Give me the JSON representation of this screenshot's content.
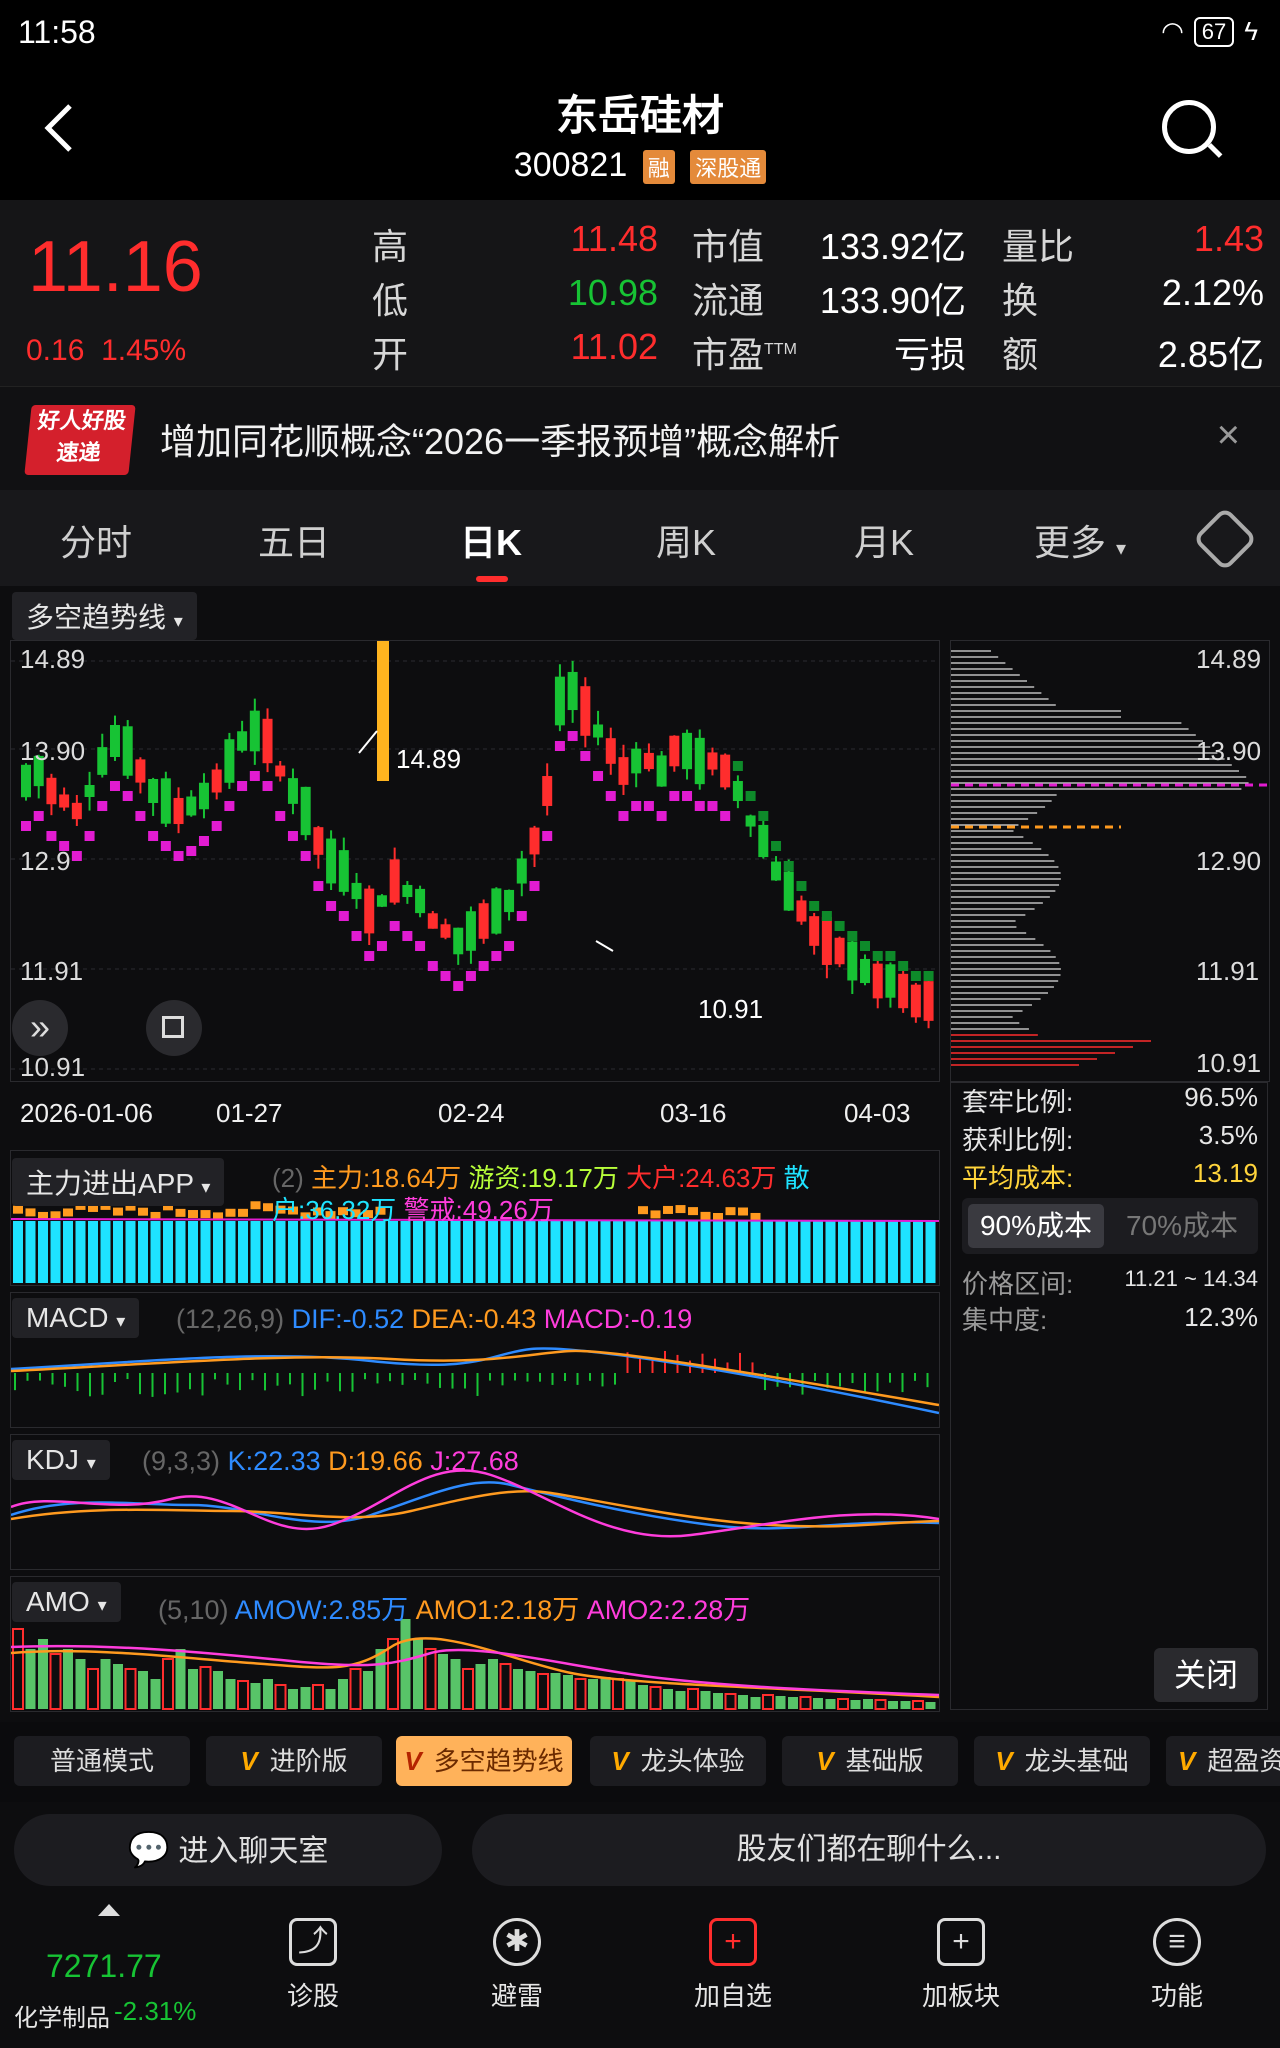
{
  "status": {
    "time": "11:58",
    "battery": "67"
  },
  "header": {
    "title": "东岳硅材",
    "code": "300821",
    "tag_margin": "融",
    "tag_connect": "深股通"
  },
  "quote": {
    "price": "11.16",
    "change": "0.16",
    "change_pct": "1.45%",
    "rows": [
      {
        "l1": "高",
        "v1": "11.48",
        "l2": "市值",
        "v2": "133.92亿",
        "l3": "量比",
        "v3": "1.43"
      },
      {
        "l1": "低",
        "v1": "10.98",
        "l2": "流通",
        "v2": "133.90亿",
        "l3": "换",
        "v3": "2.12%"
      },
      {
        "l1": "开",
        "v1": "11.02",
        "l2": "市盈",
        "l2_sup": "TTM",
        "v2": "亏损",
        "l3": "额",
        "v3": "2.85亿"
      }
    ]
  },
  "banner": {
    "logo_top": "好人好股",
    "logo_bottom": "速递",
    "text": "增加同花顺概念“2026一季报预增”概念解析",
    "close": "×"
  },
  "tabs": [
    "分时",
    "五日",
    "日K",
    "周K",
    "月K",
    "更多"
  ],
  "kline": {
    "indicator": "多空趋势线",
    "y_ticks": [
      "14.89",
      "13.90",
      "12.90",
      "11.91",
      "10.91"
    ],
    "y_label_mid": "12.9",
    "high_label": "14.89",
    "low_label": "10.91",
    "dates": [
      "2026-01-06",
      "01-27",
      "02-24",
      "03-16",
      "04-03"
    ]
  },
  "cost_panel": {
    "ticks": [
      "14.89",
      "13.90",
      "12.90",
      "11.91",
      "10.91"
    ],
    "rows": [
      {
        "label": "套牢比例:",
        "value": "96.5%",
        "color": "#e6e6e6"
      },
      {
        "label": "获利比例:",
        "value": "3.5%",
        "color": "#ff2d2d"
      },
      {
        "label": "平均成本:",
        "value": "13.19",
        "color": "#ffd43b"
      }
    ],
    "tab_active": "90%成本",
    "tab_inactive": "70%成本",
    "range_label": "价格区间:",
    "range_value": "11.21 ~ 14.34",
    "conc_label": "集中度:",
    "conc_value": "12.3%",
    "close": "关闭"
  },
  "fund_flow": {
    "indicator": "主力进出APP",
    "param": "(2)",
    "main": "主力:18.64万",
    "hot": "游资:19.17万",
    "big": "大户:24.63万",
    "retail_a": "散",
    "retail_b": "户:36.32万",
    "warn": "警戒:49.26万"
  },
  "macd": {
    "indicator": "MACD",
    "param": "(12,26,9)",
    "dif": "DIF:-0.52",
    "dea": "DEA:-0.43",
    "macd": "MACD:-0.19"
  },
  "kdj": {
    "indicator": "KDJ",
    "param": "(9,3,3)",
    "k": "K:22.33",
    "d": "D:19.66",
    "j": "J:27.68"
  },
  "amo": {
    "indicator": "AMO",
    "param": "(5,10)",
    "amow": "AMOW:2.85万",
    "amo1": "AMO1:2.18万",
    "amo2": "AMO2:2.28万"
  },
  "modes": [
    {
      "label": "普通模式",
      "v": false,
      "active": false
    },
    {
      "label": "进阶版",
      "v": true,
      "active": false
    },
    {
      "label": "多空趋势线",
      "v": true,
      "active": true
    },
    {
      "label": "龙头体验",
      "v": true,
      "active": false
    },
    {
      "label": "基础版",
      "v": true,
      "active": false
    },
    {
      "label": "龙头基础",
      "v": true,
      "active": false
    },
    {
      "label": "超盈资",
      "v": true,
      "active": false
    }
  ],
  "chat": {
    "room": "进入聊天室",
    "talk": "股友们都在聊什么..."
  },
  "bottom": {
    "index_value": "7271.77",
    "index_name": "化学制品",
    "index_change": "-2.31%",
    "nav": [
      "诊股",
      "避雷",
      "加自选",
      "加板块",
      "功能"
    ]
  }
}
